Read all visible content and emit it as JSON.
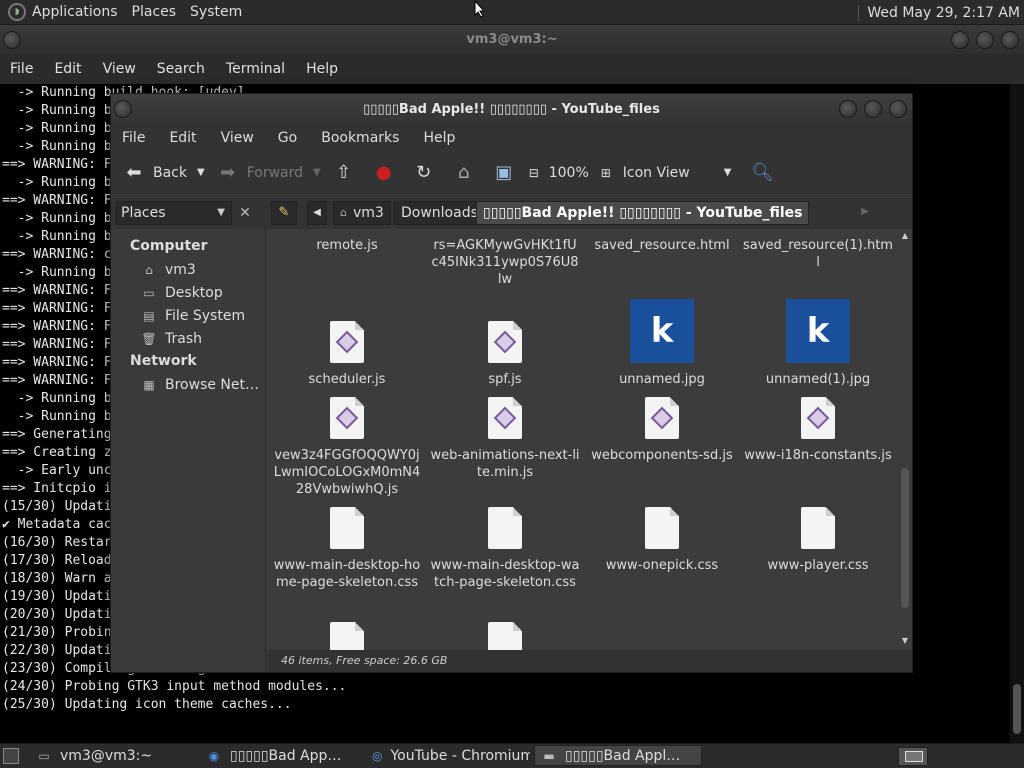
{
  "top_panel": {
    "menus": [
      "Applications",
      "Places",
      "System"
    ],
    "clock": "Wed May 29,  2:17 AM"
  },
  "terminal": {
    "title": "vm3@vm3:~",
    "menus": [
      "File",
      "Edit",
      "View",
      "Search",
      "Terminal",
      "Help"
    ],
    "lines": [
      "  -> Running build hook: [udev]",
      "  -> Running b",
      "  -> Running b",
      "  -> Running b",
      "==> WARNING: F",
      "  -> Running b",
      "==> WARNING: F",
      "  -> Running b",
      "  -> Running b",
      "==> WARNING: c",
      "  -> Running b",
      "==> WARNING: F",
      "==> WARNING: F",
      "==> WARNING: F",
      "==> WARNING: F",
      "==> WARNING: F",
      "==> WARNING: F",
      "  -> Running b",
      "  -> Running b",
      "==> Generating",
      "==> Creating z",
      "  -> Early unc",
      "==> Initcpio i",
      "(15/30) Updati",
      "✔ Metadata cac",
      "(16/30) Restar",
      "(17/30) Reload",
      "(18/30) Warn a",
      "(19/30) Updati",
      "(20/30) Updati",
      "(21/30) Probin",
      "(22/30) Updati",
      "(23/30) Compiling GSettings XML schema files...",
      "(24/30) Probing GTK3 input method modules...",
      "(25/30) Updating icon theme caches..."
    ]
  },
  "file_manager": {
    "title": "▯▯▯▯▯Bad Apple!! ▯▯▯▯▯▯▯▯ - YouTube_files",
    "menus": [
      "File",
      "Edit",
      "View",
      "Go",
      "Bookmarks",
      "Help"
    ],
    "toolbar": {
      "back": "Back",
      "forward": "Forward",
      "zoom": "100%",
      "view_mode": "Icon View"
    },
    "sidebar_select": "Places",
    "breadcrumbs": [
      "vm3",
      "Downloads",
      "▯▯▯▯▯Bad Apple!! ▯▯▯▯▯▯▯▯ - YouTube_files"
    ],
    "sidebar": {
      "computer_heading": "Computer",
      "computer_items": [
        {
          "label": "vm3",
          "icon": "home-folder-icon"
        },
        {
          "label": "Desktop",
          "icon": "desktop-folder-icon"
        },
        {
          "label": "File System",
          "icon": "drive-icon"
        },
        {
          "label": "Trash",
          "icon": "trash-icon"
        }
      ],
      "network_heading": "Network",
      "network_items": [
        {
          "label": "Browse Net…",
          "icon": "network-icon"
        }
      ]
    },
    "files": [
      {
        "name": "remote.js",
        "kind": "js",
        "partial": true
      },
      {
        "name": "rs=AGKMywGvHKt1fUc45INk311ywp0S76U8lw",
        "kind": "js",
        "partial": true
      },
      {
        "name": "saved_resource.html",
        "kind": "html",
        "partial": true
      },
      {
        "name": "saved_resource(1).html",
        "kind": "html",
        "partial": true
      },
      {
        "name": "scheduler.js",
        "kind": "js"
      },
      {
        "name": "spf.js",
        "kind": "js"
      },
      {
        "name": "unnamed.jpg",
        "kind": "img",
        "letter": "k"
      },
      {
        "name": "unnamed(1).jpg",
        "kind": "img",
        "letter": "k"
      },
      {
        "name": "vew3z4FGGfOQQWY0jLwmIOCoLOGxM0mN428VwbwiwhQ.js",
        "kind": "js"
      },
      {
        "name": "web-animations-next-lite.min.js",
        "kind": "js"
      },
      {
        "name": "webcomponents-sd.js",
        "kind": "js"
      },
      {
        "name": "www-i18n-constants.js",
        "kind": "js"
      },
      {
        "name": "www-main-desktop-home-page-skeleton.css",
        "kind": "css"
      },
      {
        "name": "www-main-desktop-watch-page-skeleton.css",
        "kind": "css"
      },
      {
        "name": "www-onepick.css",
        "kind": "css"
      },
      {
        "name": "www-player.css",
        "kind": "css"
      }
    ],
    "status": "46 items, Free space: 26.6 GB"
  },
  "taskbar": {
    "tasks": [
      {
        "label": "vm3@vm3:~",
        "icon": "terminal-icon"
      },
      {
        "label": "▯▯▯▯▯Bad App…",
        "icon": "globe-icon"
      },
      {
        "label": "YouTube - Chromium",
        "icon": "chromium-icon"
      },
      {
        "label": "▯▯▯▯▯Bad Appl…",
        "icon": "folder-icon"
      }
    ]
  }
}
